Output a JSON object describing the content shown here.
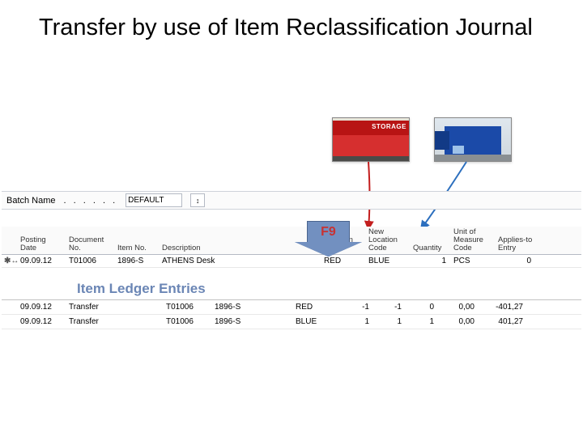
{
  "title": "Transfer by use of Item Reclassification Journal",
  "photos": {
    "red_sign": "STORAGE"
  },
  "batch_row": {
    "label": "Batch Name",
    "value": "DEFAULT",
    "lookup_icon": "↕"
  },
  "journal": {
    "headers": {
      "posting_date": "Posting\nDate",
      "document_no": "Document\nNo.",
      "item_no": "Item No.",
      "description": "Description",
      "blank1": "",
      "blank2": "",
      "location_code": "Location\nCode",
      "new_location_code": "New\nLocation\nCode",
      "quantity": "Quantity",
      "uom": "Unit of\nMeasure\nCode",
      "applies_to": "Applies-to\nEntry"
    },
    "row": {
      "posting_date": "09.09.12",
      "document_no": "T01006",
      "item_no": "1896-S",
      "description": "ATHENS Desk",
      "location_code": "RED",
      "new_location_code": "BLUE",
      "quantity": "1",
      "uom": "PCS",
      "applies_to": "0"
    }
  },
  "f9_label": "F9",
  "ile_title": "Item Ledger Entries",
  "ile_rows": [
    {
      "date": "09.09.12",
      "type": "Transfer",
      "doc": "",
      "item": "T01006",
      "lot": "1896-S",
      "desc": "",
      "loc": "RED",
      "qty": "-1",
      "inv": "-1",
      "rem": "0",
      "cost": "0,00",
      "amount": "-401,27"
    },
    {
      "date": "09.09.12",
      "type": "Transfer",
      "doc": "",
      "item": "T01006",
      "lot": "1896-S",
      "desc": "",
      "loc": "BLUE",
      "qty": "1",
      "inv": "1",
      "rem": "1",
      "cost": "0,00",
      "amount": "401,27"
    }
  ]
}
